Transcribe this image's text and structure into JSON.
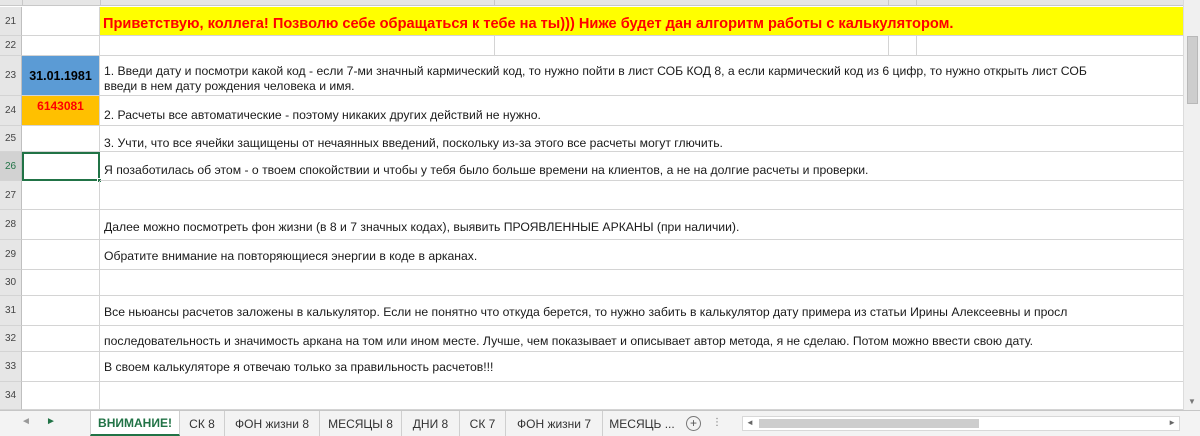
{
  "rows": {
    "r21": {
      "num": "21",
      "text": "Приветствую, коллега! Позволю себе обращаться к тебе на ты))) Ниже будет дан алгоритм работы с калькулятором."
    },
    "r22": {
      "num": "22"
    },
    "r23": {
      "num": "23",
      "date": "31.01.1981",
      "line1": "1. Введи дату и посмотри какой код - если 7-ми значный кармический код, то нужно пойти в лист СОБ КОД 8, а если кармический код из 6 цифр, то нужно открыть лист СОБ",
      "line2": "введи в нем дату рождения человека и имя."
    },
    "r24": {
      "num": "24",
      "code": "6143081",
      "text": "2. Расчеты все автоматические - поэтому никаких других действий не нужно."
    },
    "r25": {
      "num": "25",
      "text": "3. Учти, что все ячейки защищены от нечаянных введений, поскольку из-за этого все расчеты могут глючить."
    },
    "r26": {
      "num": "26",
      "text": "Я позаботилась об этом - о твоем спокойствии и чтобы у тебя было больше времени на клиентов, а не на долгие расчеты и проверки."
    },
    "r27": {
      "num": "27"
    },
    "r28": {
      "num": "28",
      "text": "Далее можно посмотреть фон жизни (в 8 и 7 значных кодах), выявить ПРОЯВЛЕННЫЕ АРКАНЫ (при наличии)."
    },
    "r29": {
      "num": "29",
      "text": "Обратите внимание на повторяющиеся энергии в коде в арканах."
    },
    "r30": {
      "num": "30"
    },
    "r31": {
      "num": "31",
      "text": "Все ньюансы расчетов заложены в калькулятор. Если не понятно что откуда берется, то нужно забить в калькулятор дату примера из статьи Ирины Алексеевны и просл"
    },
    "r32": {
      "num": "32",
      "text": "последовательность и значимость аркана на том или ином месте. Лучше, чем показывает и описывает автор метода, я не сделаю. Потом можно ввести свою дату."
    },
    "r33": {
      "num": "33",
      "text": "В своем калькуляторе я отвечаю только за правильность расчетов!!!"
    },
    "r34": {
      "num": "34"
    }
  },
  "colors": {
    "greeting_fill": "#ffff00",
    "greeting_text": "#ff0000",
    "date_fill": "#5b9bd5",
    "code_fill": "#ffc000",
    "code_text": "#ff0000",
    "accent": "#217346"
  },
  "tabs": [
    "ВНИМАНИЕ!",
    "СК 8",
    "ФОН жизни 8",
    "МЕСЯЦЫ 8",
    "ДНИ 8",
    "СК 7",
    "ФОН жизни 7",
    "МЕСЯЦЬ ..."
  ],
  "active_tab": "ВНИМАНИЕ!",
  "icons": {
    "nav_prev": "◄",
    "nav_next": "►",
    "add_sheet": "+",
    "more": "⋮"
  }
}
